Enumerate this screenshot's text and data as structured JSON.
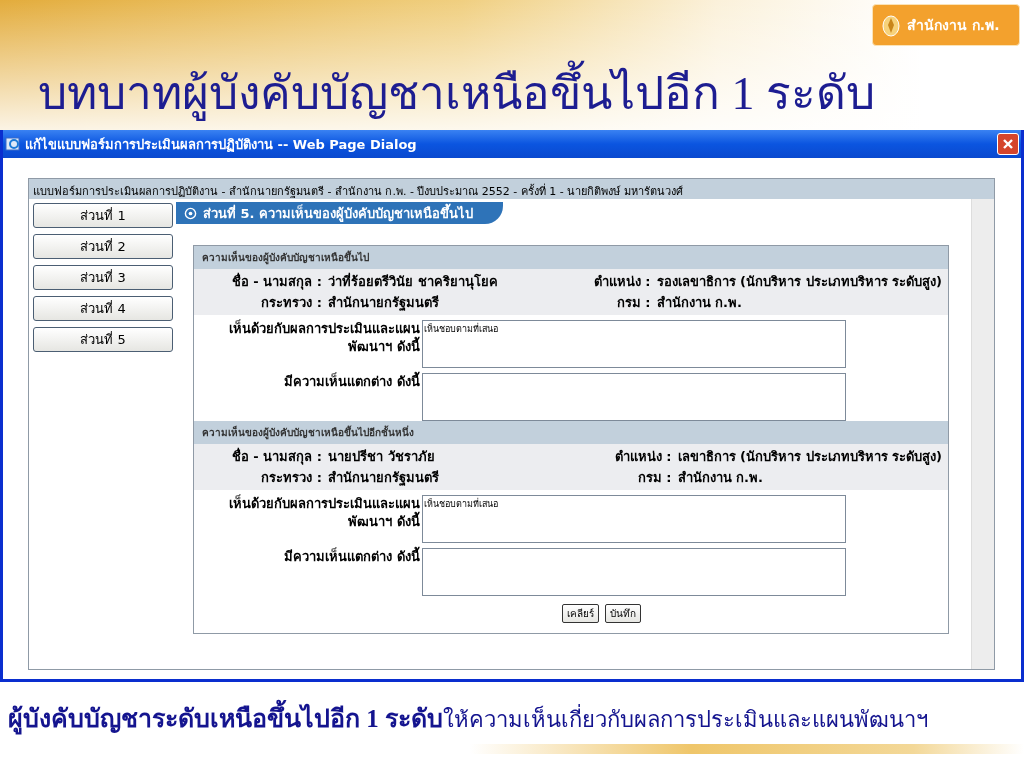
{
  "slide": {
    "title": "บทบาทผู้บังคับบัญชาเหนือขึ้นไปอีก 1 ระดับ",
    "logo": {
      "text": "สำนักงาน ก.พ."
    },
    "caption": "**ผู้บังคับบัญชาระดับเหนือขึ้นไปอีก 1 ระดับ**ให้ความเห็นเกี่ยวกับผลการประเมินและแผนพัฒนาฯ"
  },
  "dialog": {
    "title": "แก้ไขแบบฟอร์มการประเมินผลการปฏิบัติงาน -- Web Page Dialog",
    "form_header": "แบบฟอร์มการประเมินผลการปฏิบัติงาน - สำนักนายกรัฐมนตรี - สำนักงาน ก.พ. - ปีงบประมาณ 2552 - ครั้งที่ 1 - นายกิติพงษ์ มหารัตนวงศ์",
    "nav": [
      {
        "label": "ส่วนที่ 1"
      },
      {
        "label": "ส่วนที่ 2"
      },
      {
        "label": "ส่วนที่ 3"
      },
      {
        "label": "ส่วนที่ 4"
      },
      {
        "label": "ส่วนที่ 5"
      }
    ],
    "section_title": "ส่วนที่ 5. ความเห็นของผู้บังคับบัญชาเหนือขึ้นไป",
    "panels": [
      {
        "heading": "ความเห็นของผู้บังคับบัญชาเหนือขึ้นไป",
        "info": [
          {
            "label": "ชื่อ - นามสกุล :",
            "value": "ว่าที่ร้อยตรีวินัย ชาคริยานุโยค"
          },
          {
            "label": "ตำแหน่ง :",
            "value": "รองเลขาธิการ (นักบริหาร ประเภทบริหาร ระดับสูง)"
          },
          {
            "label": "กระทรวง :",
            "value": "สำนักนายกรัฐมนตรี"
          },
          {
            "label": "กรม :",
            "value": "สำนักงาน ก.พ."
          }
        ],
        "comments": [
          {
            "label": "เห็นด้วยกับผลการประเมินและแผนพัฒนาฯ ดังนี้",
            "value": "เห็นชอบตามที่เสนอ"
          },
          {
            "label": "มีความเห็นแตกต่าง ดังนี้"
          }
        ]
      },
      {
        "heading": "ความเห็นของผู้บังคับบัญชาเหนือขึ้นไปอีกชั้นหนึ่ง",
        "info": [
          {
            "label": "ชื่อ - นามสกุล :",
            "value": "นายปรีชา วัชราภัย"
          },
          {
            "label": "ตำแหน่ง :",
            "value": "เลขาธิการ (นักบริหาร ประเภทบริหาร ระดับสูง)"
          },
          {
            "label": "กระทรวง :",
            "value": "สำนักนายกรัฐมนตรี"
          },
          {
            "label": "กรม :",
            "value": "สำนักงาน ก.พ."
          }
        ],
        "comments": [
          {
            "label": "เห็นด้วยกับผลการประเมินและแผนพัฒนาฯ ดังนี้",
            "value": "เห็นชอบตามที่เสนอ"
          },
          {
            "label": "มีความเห็นแตกต่าง ดังนี้"
          }
        ],
        "buttons": [
          "เคลียร์",
          "บันทึก"
        ]
      }
    ]
  }
}
